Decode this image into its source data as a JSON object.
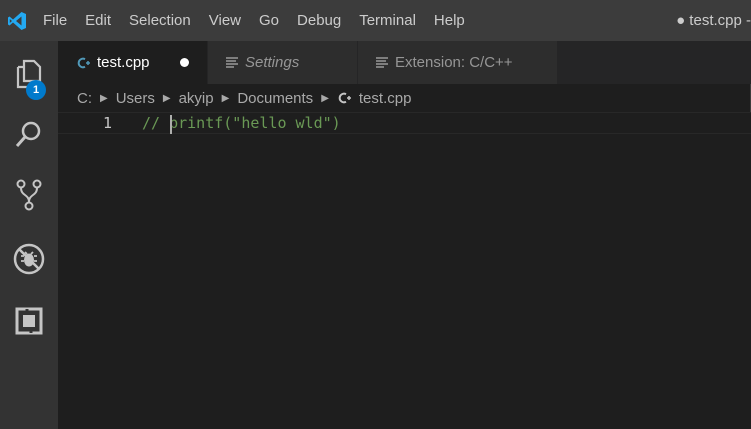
{
  "titlebar": {
    "menu": [
      "File",
      "Edit",
      "Selection",
      "View",
      "Go",
      "Debug",
      "Terminal",
      "Help"
    ],
    "window_title": "● test.cpp -"
  },
  "activitybar": {
    "items": [
      {
        "name": "explorer-icon",
        "badge": "1"
      },
      {
        "name": "search-icon"
      },
      {
        "name": "source-control-icon"
      },
      {
        "name": "debug-icon"
      },
      {
        "name": "extensions-icon"
      }
    ]
  },
  "tabs": [
    {
      "label": "test.cpp",
      "icon": "cpp-file-icon",
      "active": true,
      "dirty": true
    },
    {
      "label": "Settings",
      "icon": "settings-lines-icon",
      "active": false,
      "italic": true
    },
    {
      "label": "Extension: C/C++",
      "icon": "extension-lines-icon",
      "active": false
    }
  ],
  "breadcrumb": [
    "C:",
    "Users",
    "akyip",
    "Documents",
    "test.cpp"
  ],
  "editor": {
    "lines": [
      {
        "number": "1",
        "text": "// printf(\"hello wld\")"
      }
    ]
  },
  "colors": {
    "accent": "#007acc",
    "comment": "#6a9955",
    "cpp_icon": "#519aba"
  }
}
